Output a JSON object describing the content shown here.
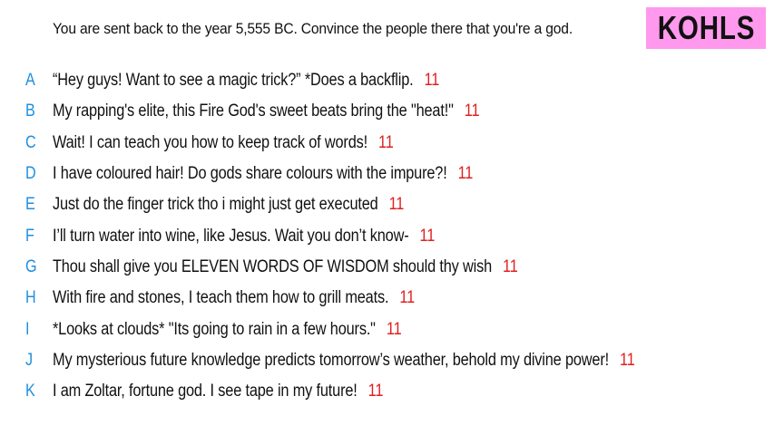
{
  "header": {
    "prompt": "You are sent back to the year 5,555 BC. Convince the people there that you're a god.",
    "badge": "KOHLS",
    "badge_color": "#ff99ee"
  },
  "colors": {
    "letter": "#1e8fe0",
    "score": "#e02020"
  },
  "answers": [
    {
      "letter": "A",
      "text": "“Hey guys! Want to see a magic trick?” *Does a backflip.",
      "score": "11"
    },
    {
      "letter": "B",
      "text": "My rapping's elite, this Fire God's sweet beats bring the \"heat!\"",
      "score": "11"
    },
    {
      "letter": "C",
      "text": "Wait! I can teach you how to keep track of words!",
      "score": "11"
    },
    {
      "letter": "D",
      "text": "I have coloured hair! Do gods share colours with the impure?!",
      "score": "11"
    },
    {
      "letter": "E",
      "text": "Just do the finger trick tho i might just get executed",
      "score": "11"
    },
    {
      "letter": "F",
      "text": "I’ll turn water into wine, like Jesus. Wait you don’t know-",
      "score": "11"
    },
    {
      "letter": "G",
      "text": "Thou shall give you ELEVEN WORDS OF WISDOM should thy wish",
      "score": "11"
    },
    {
      "letter": "H",
      "text": "With fire and stones, I teach them how to grill meats.",
      "score": "11"
    },
    {
      "letter": "I",
      "text": "*Looks at clouds* \"Its going to rain in a few hours.\"",
      "score": "11"
    },
    {
      "letter": "J",
      "text": "My mysterious future knowledge predicts tomorrow’s weather, behold my divine power!",
      "score": "11"
    },
    {
      "letter": "K",
      "text": "I am Zoltar, fortune god. I see tape in my future!",
      "score": "11"
    }
  ]
}
